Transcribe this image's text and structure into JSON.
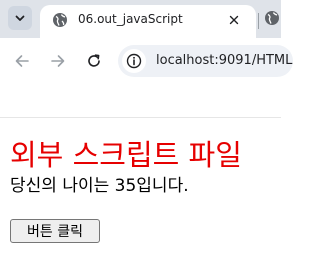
{
  "browser": {
    "tab": {
      "title": "06.out_javaScript",
      "favicon": "globe-icon"
    },
    "second_tab": {
      "favicon": "globe-icon"
    },
    "toolbar": {
      "address": "localhost:9091/HTML",
      "site_info_icon": "info-icon"
    }
  },
  "page": {
    "heading": "외부 스크립트 파일",
    "text_before": "당신의 나이는 ",
    "age": "35",
    "text_after": "입니다.",
    "button_label": "버튼 클릭"
  },
  "colors": {
    "heading": "#e60000",
    "tabstrip": "#dfe3e9",
    "omnibox": "#eef1f6"
  }
}
